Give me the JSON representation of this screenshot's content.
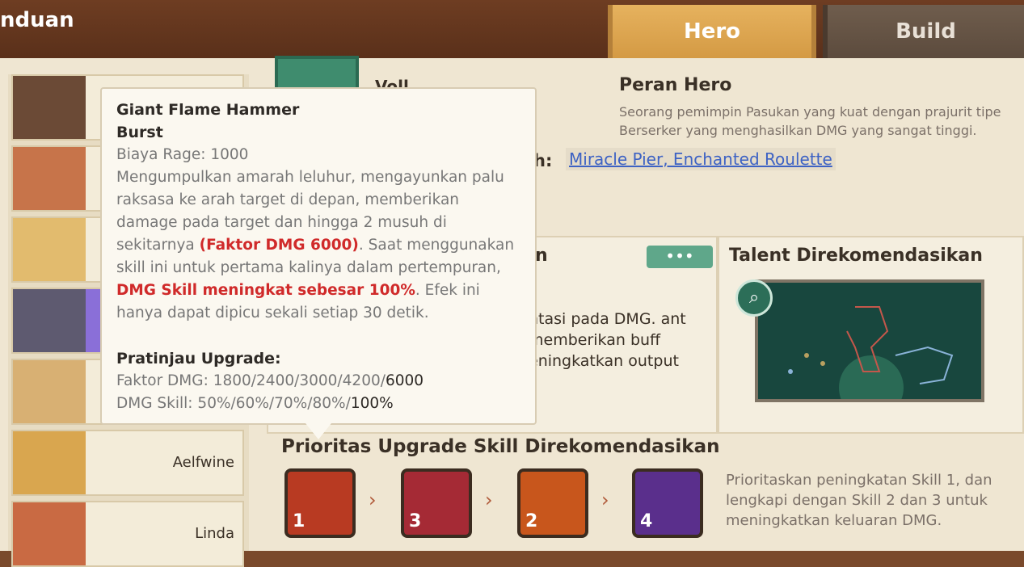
{
  "header": {
    "title": "nduan"
  },
  "tabs": [
    {
      "label": "Hero"
    },
    {
      "label": "Build"
    }
  ],
  "heroes": [
    {
      "name": ""
    },
    {
      "name": ""
    },
    {
      "name": ""
    },
    {
      "name": ""
    },
    {
      "name": ""
    },
    {
      "name": "Aelfwine"
    },
    {
      "name": "Linda"
    }
  ],
  "hero": {
    "name": "Voll"
  },
  "role": {
    "heading": "Peran Hero",
    "text": "Seorang pemimpin Pasukan yang kuat dengan prajurit tipe Berserker yang menghasilkan DMG yang sangat tinggi."
  },
  "recommended": {
    "label": "h:",
    "links": "Miracle Pier, Enchanted Roulette"
  },
  "skill_panel": {
    "heading_fragment": "n",
    "more_label": "•••",
    "text": "ntasi pada DMG. ant memberikan buff eningkatkan output"
  },
  "talent": {
    "heading": "Talent Direkomendasikan"
  },
  "priority": {
    "heading": "Prioritas Upgrade Skill Direkomendasikan",
    "skills": [
      "1",
      "3",
      "2",
      "4"
    ],
    "text": "Prioritaskan peningkatan Skill 1, dan lengkapi dengan Skill 2 dan 3 untuk meningkatkan keluaran DMG."
  },
  "tooltip": {
    "name": "Giant Flame Hammer",
    "type": "Burst",
    "cost": "Biaya Rage: 1000",
    "desc_1": "Mengumpulkan amarah leluhur, mengayunkan palu raksasa ke arah target di depan, memberikan damage pada target dan hingga 2 musuh di sekitarnya ",
    "desc_red_1": "(Faktor DMG 6000)",
    "desc_2": ". Saat menggunakan skill ini untuk pertama kalinya dalam pertempuran, ",
    "desc_red_2": "DMG Skill meningkat sebesar 100%",
    "desc_3": ". Efek ini hanya dapat dipicu sekali setiap 30 detik.",
    "upgrade_heading": "Pratinjau Upgrade:",
    "dmg_label": "Faktor DMG: ",
    "dmg_values": "1800/2400/3000/4200/",
    "dmg_final": "6000",
    "skill_label": "DMG Skill: ",
    "skill_values": "50%/60%/70%/80%/",
    "skill_final": "100%"
  },
  "colors": {
    "accent_green": "#5fa78a",
    "tab_active": "#e6b25e",
    "link": "#3d62c4",
    "highlight_red": "#d02a2a"
  }
}
